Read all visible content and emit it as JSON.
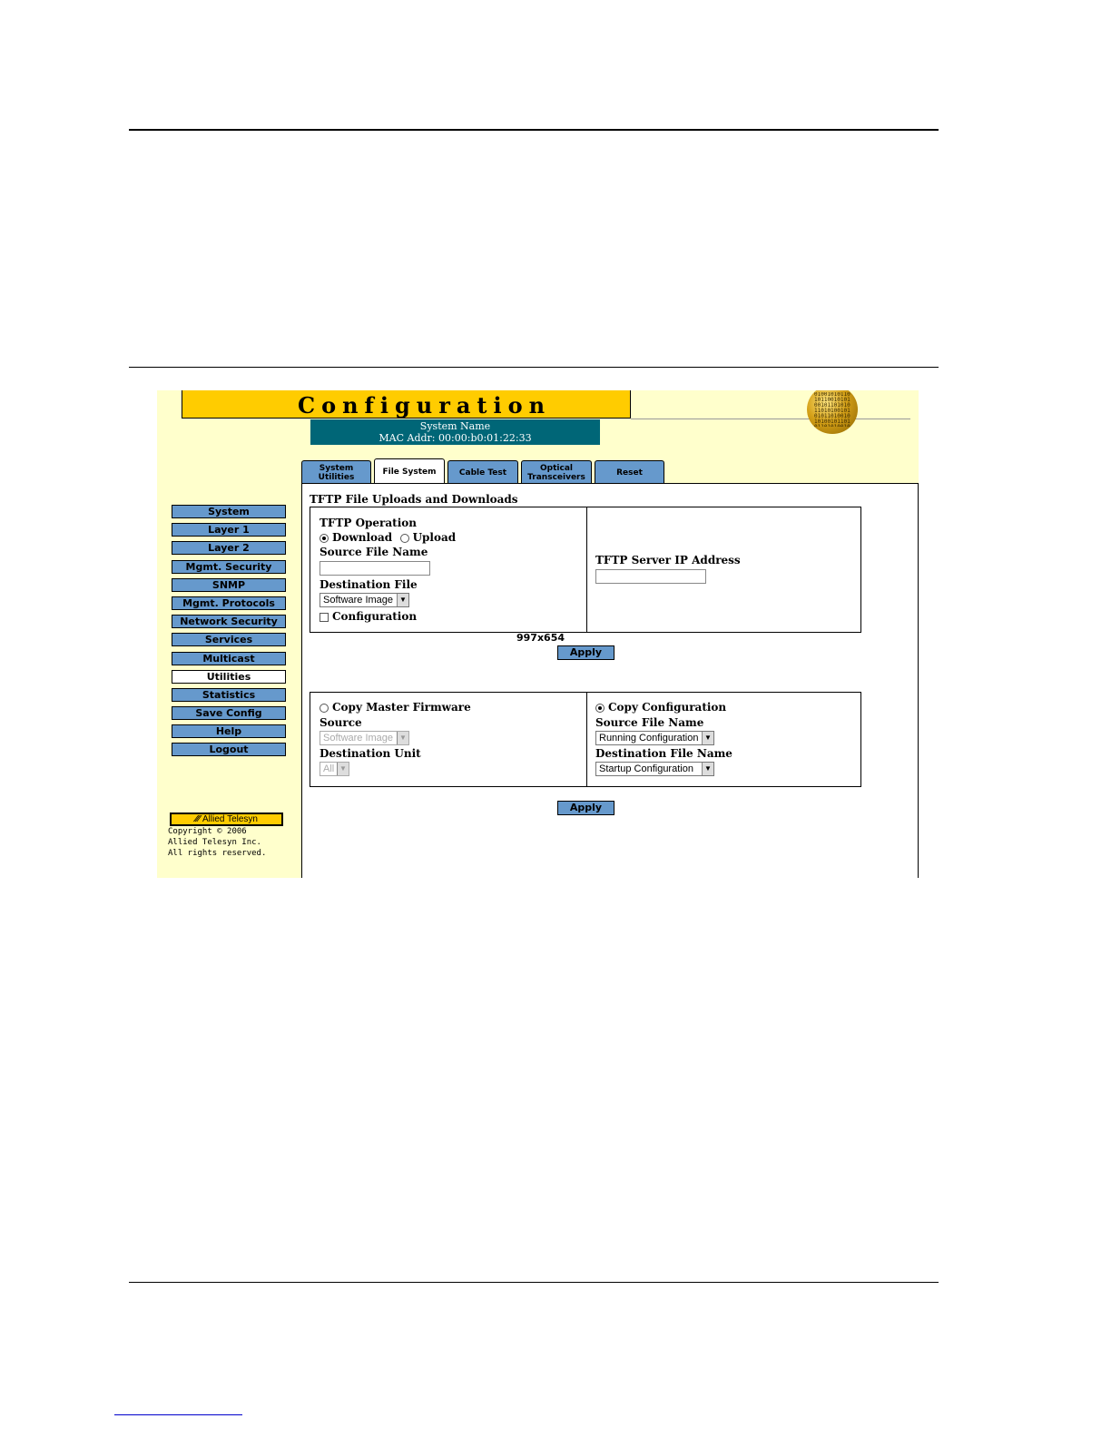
{
  "header": {
    "title": "Configuration",
    "system_name": "System Name",
    "mac_label": "MAC Addr:",
    "mac_value": "00:00:b0:01:22:33"
  },
  "globe_icon": "globe-icon",
  "nav": {
    "items": [
      "System",
      "Layer 1",
      "Layer 2",
      "Mgmt. Security",
      "SNMP",
      "Mgmt. Protocols",
      "Network Security",
      "Services",
      "Multicast",
      "Utilities",
      "Statistics",
      "Save Config",
      "Help",
      "Logout"
    ],
    "active": "Utilities"
  },
  "logo": {
    "text": "Allied Telesyn"
  },
  "copyright": {
    "line1": "Copyright © 2006",
    "line2": "Allied Telesyn Inc.",
    "line3": "All rights reserved."
  },
  "tabs": [
    {
      "line1": "System",
      "line2": "Utilities"
    },
    {
      "line1": "File System",
      "line2": ""
    },
    {
      "line1": "Cable Test",
      "line2": ""
    },
    {
      "line1": "Optical",
      "line2": "Transceivers"
    },
    {
      "line1": "Reset",
      "line2": ""
    }
  ],
  "tftp": {
    "section_title": "TFTP File Uploads and Downloads",
    "operation_label": "TFTP Operation",
    "download_label": "Download",
    "upload_label": "Upload",
    "selected": "Download",
    "source_file_label": "Source File Name",
    "source_file_value": "",
    "destination_label": "Destination File",
    "destination_value": "Software Image",
    "configuration_label": "Configuration",
    "configuration_checked": false,
    "server_ip_label": "TFTP Server IP Address",
    "server_ip_value": "",
    "apply_label": "Apply"
  },
  "dims_text": "997x654",
  "copy": {
    "master_firmware_label": "Copy Master Firmware",
    "source_label": "Source",
    "source_value": "Software Image",
    "destination_unit_label": "Destination Unit",
    "destination_unit_value": "All",
    "copy_config_label": "Copy Configuration",
    "selected": "Copy Configuration",
    "source_file_label": "Source File Name",
    "source_file_value": "Running Configuration",
    "dest_file_label": "Destination File Name",
    "dest_file_value": "Startup Configuration",
    "apply_label": "Apply"
  },
  "colors": {
    "title_bg": "#ffcc00",
    "app_bg": "#ffffcc",
    "button_bg": "#6699cc",
    "sysbox_bg": "#006677"
  }
}
